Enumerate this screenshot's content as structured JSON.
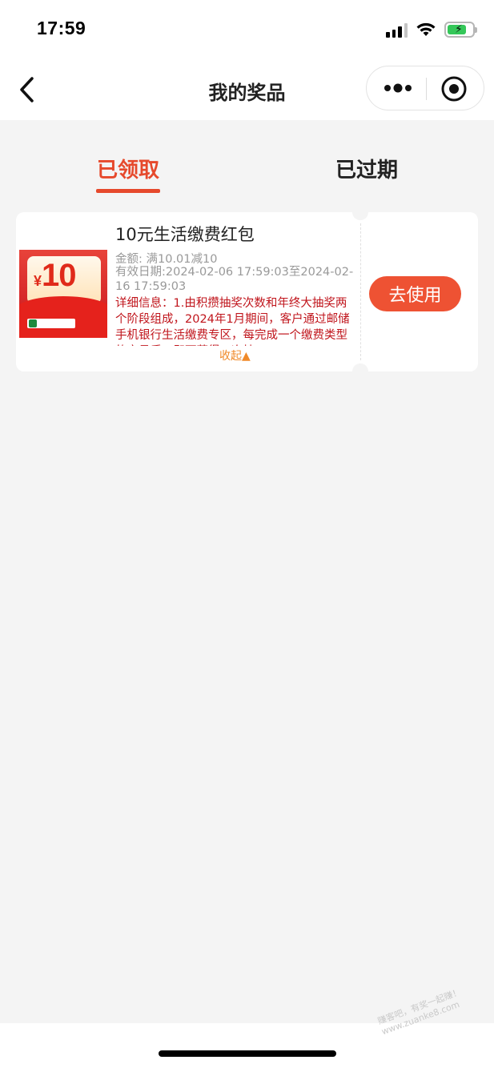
{
  "status_bar": {
    "time": "17:59"
  },
  "nav": {
    "title": "我的奖品",
    "back_icon": "chevron-left-icon",
    "more_icon": "more-dots-icon",
    "close_icon": "target-circle-icon"
  },
  "tabs": [
    {
      "label": "已领取",
      "active": true
    },
    {
      "label": "已过期",
      "active": false
    }
  ],
  "colors": {
    "accent": "#e6492c",
    "button": "#ee5233",
    "detail_text": "#c0151c",
    "collapse_text": "#f08a2a"
  },
  "coupons": [
    {
      "title": "10元生活缴费红包",
      "image_currency": "¥",
      "image_value": "10",
      "amount": "金额: 满10.01减10",
      "validity": "有效日期:2024-02-06 17:59:03至2024-02-16 17:59:03",
      "detail": "详细信息：1.由积攒抽奖次数和年终大抽奖两个阶段组成，2024年1月期间，客户通过邮储手机银行生活缴费专区，每完成一个缴费类型的交易后，即可获得一次抽",
      "collapse_label": "收起▲",
      "action_label": "去使用"
    }
  ],
  "watermark": {
    "line1": "赚客吧，有奖一起赚！",
    "line2": "www.zuanke8.com"
  }
}
